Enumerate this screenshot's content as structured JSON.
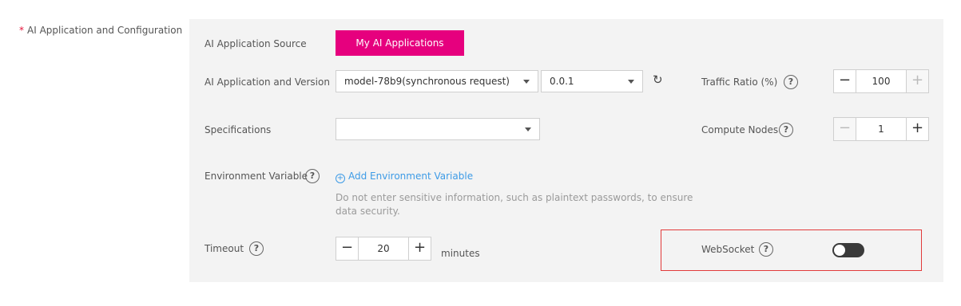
{
  "section": {
    "required_mark": "*",
    "title": "AI Application and Configuration"
  },
  "source": {
    "label": "AI Application Source",
    "button_label": "My AI Applications"
  },
  "app_version": {
    "label": "AI Application and Version",
    "app_value": "model-78b9(synchronous request)",
    "version_value": "0.0.1"
  },
  "traffic": {
    "label": "Traffic Ratio (%)",
    "value": "100"
  },
  "specifications": {
    "label": "Specifications",
    "value": ""
  },
  "compute_nodes": {
    "label": "Compute Nodes",
    "value": "1"
  },
  "env": {
    "label": "Environment Variable",
    "add_link": "Add Environment Variable",
    "hint": "Do not enter sensitive information, such as plaintext passwords, to ensure data security."
  },
  "timeout": {
    "label": "Timeout",
    "value": "20",
    "unit": "minutes"
  },
  "websocket": {
    "label": "WebSocket",
    "enabled": false
  },
  "icons": {
    "help": "?",
    "refresh": "↻",
    "minus": "−",
    "plus": "+"
  },
  "colors": {
    "primary_button": "#e6007e",
    "link": "#3d9be6",
    "highlight_border": "#e23a3a",
    "required": "#e5133a"
  }
}
